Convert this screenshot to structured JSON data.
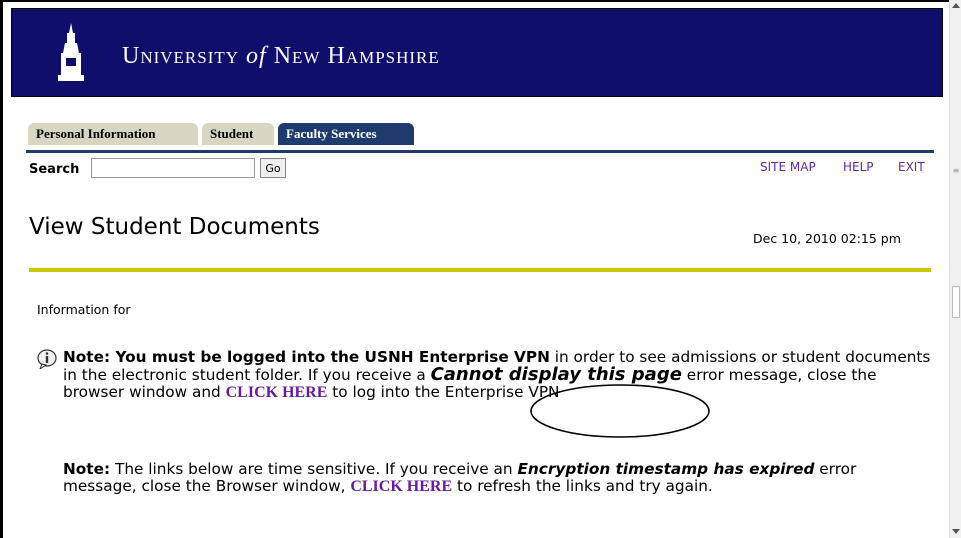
{
  "banner": {
    "title_part1": "University ",
    "title_of": "of",
    "title_part2": " New Hampshire",
    "logo_icon": "tower-logo-icon"
  },
  "tabs": [
    {
      "label": "Personal Information"
    },
    {
      "label": "Student"
    },
    {
      "label": "Faculty Services",
      "active": true
    }
  ],
  "search": {
    "label": "Search",
    "value": "",
    "placeholder": "",
    "button_label": "Go"
  },
  "top_links": {
    "site_map": "SITE MAP",
    "help": "HELP",
    "exit": "EXIT"
  },
  "page": {
    "title": "View Student Documents",
    "date": "Dec 10, 2010 02:15 pm",
    "info_for": "Information for"
  },
  "note1": {
    "bold_lead": "Note: You must be logged into the USNH Enterprise VPN",
    "text1": " in order to see admissions or student documents in the electronic student folder. If you receive a ",
    "emph": "Cannot display this page",
    "text2": " error message, close the browser window and ",
    "link": "CLICK HERE",
    "text3": " to log into the Enterprise VPN"
  },
  "note2": {
    "bold_lead": "Note:",
    "text1": " The links below are time sensitive. If you receive an ",
    "emph": "Encryption timestamp has expired",
    "text2": " error message, close the Browser window, ",
    "link": "CLICK HERE",
    "text3": " to refresh the links and try again."
  },
  "colors": {
    "banner": "#0f0f6b",
    "tab_active": "#1f3a6d",
    "tab_inactive": "#d6d6c2",
    "rule": "#c8c800",
    "link": "#6a1b9a"
  }
}
